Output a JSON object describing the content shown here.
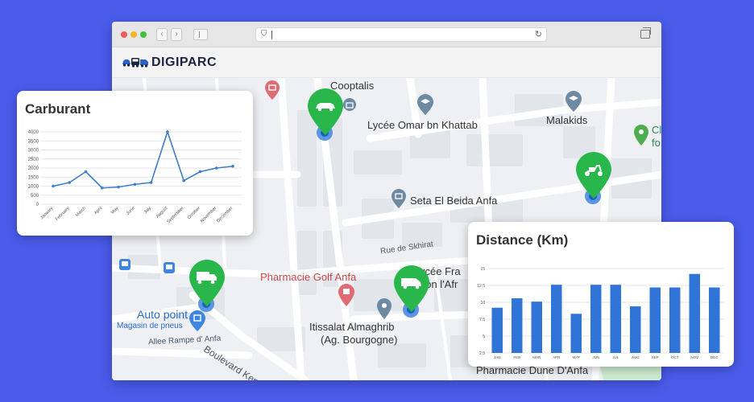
{
  "app": {
    "name": "DIGIPARC",
    "url_text": "|"
  },
  "colors": {
    "background": "#4a5bea",
    "marker": "#29b64a",
    "line": "#3d7fc8",
    "bar": "#2f74d6"
  },
  "map": {
    "labels": [
      {
        "id": "cooptalis",
        "text": "Cooptalis"
      },
      {
        "id": "lycee-omar",
        "text": "Lycée Omar bn Khattab"
      },
      {
        "id": "malakids",
        "text": "Malakids"
      },
      {
        "id": "cl-fo-1",
        "text": "Cl"
      },
      {
        "id": "cl-fo-2",
        "text": "fo"
      },
      {
        "id": "seta",
        "text": "Seta El Beida Anfa"
      },
      {
        "id": "rue-skhirat",
        "text": "Rue de Skhirat"
      },
      {
        "id": "lycee-fr-1",
        "text": "ycée Fra"
      },
      {
        "id": "lycee-fr-2",
        "text": "éon l'Afr"
      },
      {
        "id": "pharmacie-golf",
        "text": "Pharmacie Golf Anfa"
      },
      {
        "id": "auto-point",
        "text": "Auto point"
      },
      {
        "id": "magasin",
        "text": "Magasin de pneus"
      },
      {
        "id": "boulevard",
        "text": "Boulevard Kennedy"
      },
      {
        "id": "allee",
        "text": "Allee Rampe d' Anfa"
      },
      {
        "id": "itissalat-1",
        "text": "Itissalat Almaghrib"
      },
      {
        "id": "itissalat-2",
        "text": "(Ag. Bourgogne)"
      },
      {
        "id": "pharmacie-dune",
        "text": "Pharmacie Dune D'Anfa"
      }
    ],
    "markers": [
      {
        "vehicle": "car-icon"
      },
      {
        "vehicle": "scooter-icon"
      },
      {
        "vehicle": "truck-icon"
      },
      {
        "vehicle": "van-icon"
      }
    ]
  },
  "carburant_card": {
    "title": "Carburant"
  },
  "distance_card": {
    "title": "Distance (Km)"
  },
  "chart_data": [
    {
      "type": "line",
      "title": "Carburant",
      "categories": [
        "January",
        "February",
        "March",
        "April",
        "May",
        "June",
        "July",
        "August",
        "September",
        "October",
        "November",
        "December"
      ],
      "values": [
        1000,
        1200,
        1800,
        900,
        950,
        1100,
        1200,
        4000,
        1300,
        1800,
        2000,
        2100
      ],
      "ylim": [
        0,
        4000
      ],
      "yticks": [
        "0",
        "500",
        "1000",
        "1500",
        "2000",
        "2500",
        "3000",
        "3500",
        "4000"
      ],
      "grid": true
    },
    {
      "type": "bar",
      "title": "Distance (Km)",
      "categories": [
        "JAN",
        "FEB",
        "MAR",
        "APR",
        "MAY",
        "JUN",
        "JUL",
        "AUG",
        "SEP",
        "OCT",
        "NOV",
        "DEC"
      ],
      "values": [
        9.2,
        10.6,
        10.1,
        12.6,
        8.3,
        12.6,
        12.6,
        9.4,
        12.2,
        12.2,
        14.2,
        12.2
      ],
      "ylim": [
        2.5,
        15
      ],
      "yticks": [
        "2.5",
        "5",
        "7.5",
        "10",
        "12.5",
        "15"
      ],
      "grid": true
    }
  ]
}
